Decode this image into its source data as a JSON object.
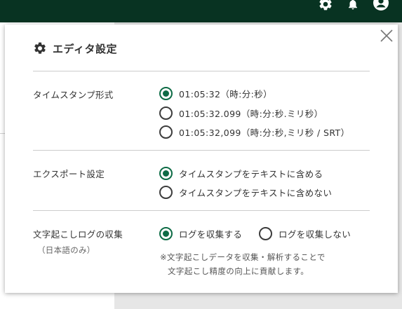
{
  "colors": {
    "topbar": "#083322",
    "accent": "#0d6b45"
  },
  "topbar": {
    "icons": [
      "gear-icon",
      "bell-icon",
      "user-icon"
    ]
  },
  "modal": {
    "title": "エディタ設定",
    "sections": {
      "timestamp_format": {
        "label": "タイムスタンプ形式",
        "options": [
          {
            "label": "01:05:32（時:分:秒）",
            "checked": true
          },
          {
            "label": "01:05:32.099（時:分:秒.ミリ秒）",
            "checked": false
          },
          {
            "label": "01:05:32,099（時:分:秒,ミリ秒 / SRT）",
            "checked": false
          }
        ]
      },
      "export": {
        "label": "エクスポート設定",
        "options": [
          {
            "label": "タイムスタンプをテキストに含める",
            "checked": true
          },
          {
            "label": "タイムスタンプをテキストに含めない",
            "checked": false
          }
        ]
      },
      "log": {
        "label": "文字起こしログの収集",
        "sublabel": "（日本語のみ）",
        "options": [
          {
            "label": "ログを収集する",
            "checked": true
          },
          {
            "label": "ログを収集しない",
            "checked": false
          }
        ],
        "note_line1": "※文字起こしデータを収集・解析することで",
        "note_line2": "文字起こし精度の向上に貢献します。"
      }
    }
  }
}
